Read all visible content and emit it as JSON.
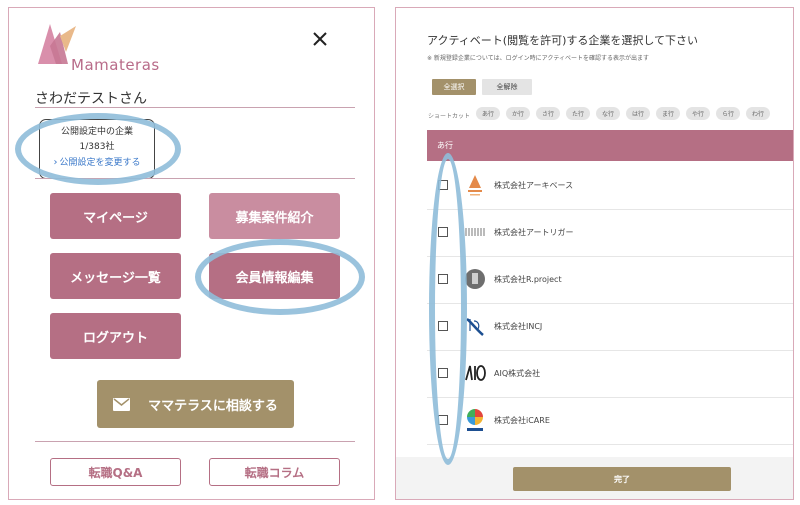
{
  "left": {
    "brand": "Mamateras",
    "user_name": "さわだテストさん",
    "public_box": {
      "title": "公開設定中の企業",
      "count": "1/383社",
      "link": "公開設定を変更する"
    },
    "buttons": {
      "mypage": "マイページ",
      "job_intro": "募集案件紹介",
      "messages": "メッセージ一覧",
      "member_edit": "会員情報編集",
      "logout": "ログアウト",
      "consult": "ママテラスに相談する",
      "faq": "転職Q&A",
      "column": "転職コラム"
    }
  },
  "right": {
    "title": "アクティベート(閲覧を許可)する企業を選択して下さい",
    "subtitle": "※ 新規登録企業については、ログイン時にアクティベートを確認する表示が出ます",
    "select_all": "全選択",
    "clear_all": "全解除",
    "shortcut_label": "ショートカット",
    "shortcuts": [
      "あ行",
      "か行",
      "さ行",
      "た行",
      "な行",
      "は行",
      "ま行",
      "や行",
      "ら行",
      "わ行"
    ],
    "group_header": "あ行",
    "companies": [
      {
        "name": "株式会社アーキベース"
      },
      {
        "name": "株式会社アートリガー"
      },
      {
        "name": "株式会社R.project"
      },
      {
        "name": "株式会社INCJ"
      },
      {
        "name": "AIQ株式会社"
      },
      {
        "name": "株式会社iCARE"
      }
    ],
    "done": "完了"
  },
  "colors": {
    "mauve": "#b56f84",
    "mauve_light": "#c98da0",
    "gold": "#a3916a",
    "highlight": "#8fbcd9"
  }
}
